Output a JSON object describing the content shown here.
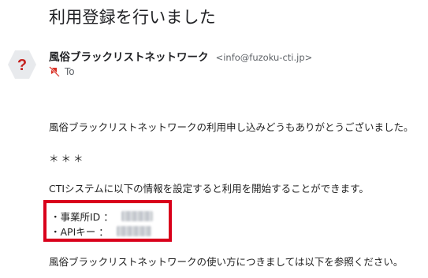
{
  "email": {
    "subject": "利用登録を行いました",
    "sender": {
      "name": "風俗ブラックリストネットワーク",
      "email": "<info@fuzoku-cti.jp>",
      "avatar_symbol": "?",
      "avatar_color": "#e8eaed",
      "avatar_symbol_color": "#c5221f"
    },
    "recipient_label": "To",
    "body": {
      "paragraph1": "風俗ブラックリストネットワークの利用申し込みどうもありがとうございました。",
      "separator": "＊＊＊",
      "paragraph2": "CTIシステムに以下の情報を設定すると利用を開始することができます。",
      "credentials": [
        {
          "label": "・事業所ID ："
        },
        {
          "label": "・APIキー ："
        }
      ],
      "paragraph3": "風俗ブラックリストネットワークの使い方につきましては以下を参照ください。"
    },
    "highlight_color": "#d9001b"
  }
}
